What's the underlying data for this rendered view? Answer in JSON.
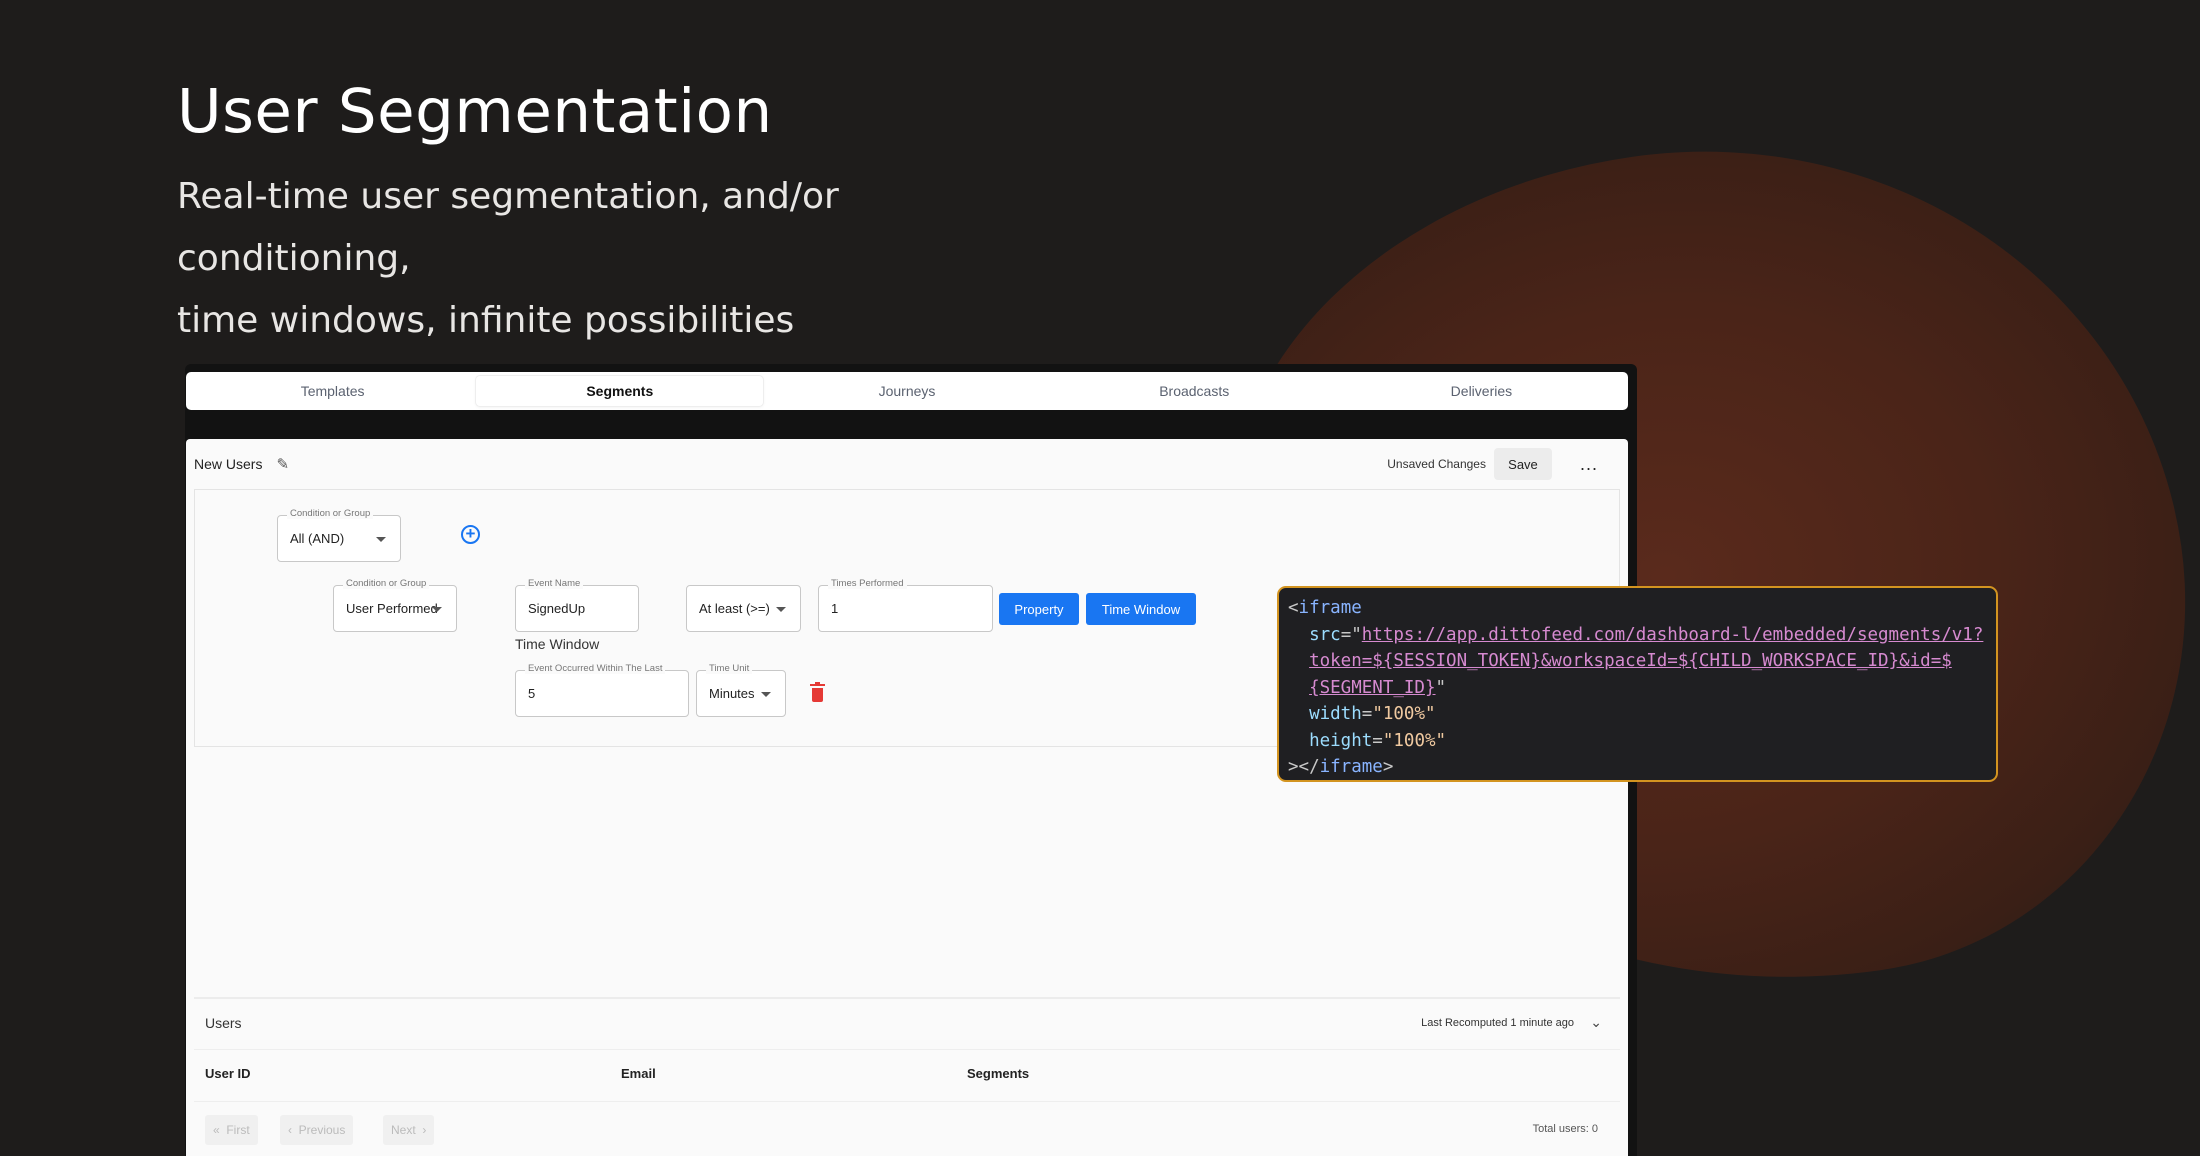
{
  "hero": {
    "title": "User Segmentation",
    "subtitle_line1": "Real-time user segmentation, and/or conditioning,",
    "subtitle_line2": "time windows, infinite possibilities"
  },
  "tabs": [
    {
      "label": "Templates",
      "active": false
    },
    {
      "label": "Segments",
      "active": true
    },
    {
      "label": "Journeys",
      "active": false
    },
    {
      "label": "Broadcasts",
      "active": false
    },
    {
      "label": "Deliveries",
      "active": false
    }
  ],
  "segment": {
    "name": "New Users",
    "unsaved_label": "Unsaved Changes",
    "save_label": "Save",
    "more_label": "..."
  },
  "editor": {
    "group_label": "Condition or Group",
    "group_value": "All (AND)",
    "condition_label": "Condition or Group",
    "condition_value": "User Performed",
    "event_label": "Event Name",
    "event_value": "SignedUp",
    "operator_value": "At least (>=)",
    "times_label": "Times Performed",
    "times_value": "1",
    "property_label": "Property",
    "time_window_label": "Time Window",
    "time_window_heading": "Time Window",
    "within_label": "Event Occurred Within The Last",
    "within_value": "5",
    "unit_label": "Time Unit",
    "unit_value": "Minutes"
  },
  "users": {
    "title": "Users",
    "recomputed": "Last Recomputed 1 minute ago",
    "columns": [
      "User ID",
      "Email",
      "Segments"
    ],
    "pagination": {
      "first": "First",
      "previous": "Previous",
      "next": "Next"
    },
    "total": "Total users: 0"
  },
  "code": {
    "tag": "iframe",
    "src_url_1": "https://app.dittofeed.com/dashboard-l/embedded/segments/v1?",
    "src_url_2": "token=${SESSION_TOKEN}&workspaceId=${CHILD_WORKSPACE_ID}&id=$",
    "src_url_3": "{SEGMENT_ID}",
    "width_value": "100%",
    "height_value": "100%"
  },
  "colors": {
    "accent": "#1976f2",
    "code_border": "#d39420",
    "danger": "#e53935"
  }
}
